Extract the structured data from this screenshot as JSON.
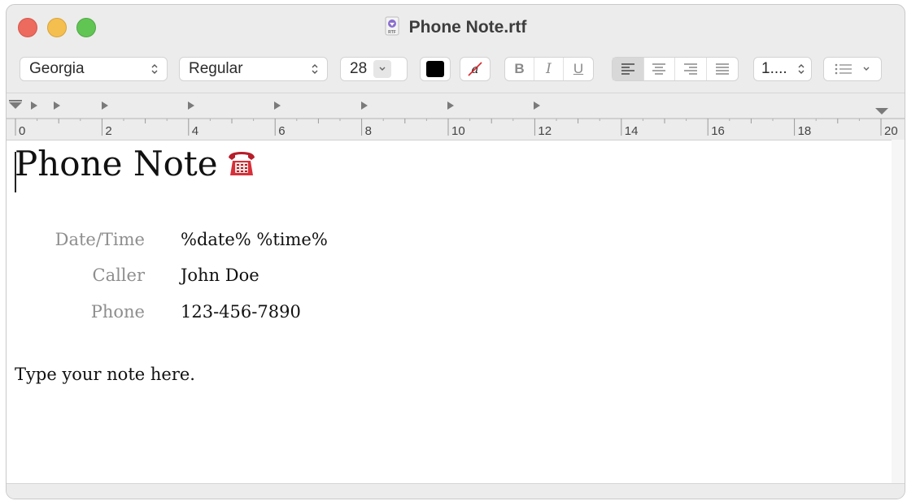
{
  "window": {
    "title": "Phone Note.rtf",
    "file_icon_label": "RTF"
  },
  "toolbar": {
    "font_family": "Georgia",
    "font_style": "Regular",
    "font_size": "28",
    "text_color": "#000000",
    "bold_label": "B",
    "italic_label": "I",
    "underline_label": "U",
    "line_spacing": "1....",
    "alignment_selected": "left"
  },
  "ruler": {
    "labels": [
      "0",
      "2",
      "4",
      "6",
      "8",
      "10",
      "12",
      "14",
      "16",
      "18",
      "20"
    ]
  },
  "document": {
    "heading": "Phone Note",
    "fields": [
      {
        "label": "Date/Time",
        "value": "%date% %time%"
      },
      {
        "label": "Caller",
        "value": "John Doe"
      },
      {
        "label": "Phone",
        "value": "123-456-7890"
      }
    ],
    "note": "Type your note here."
  }
}
